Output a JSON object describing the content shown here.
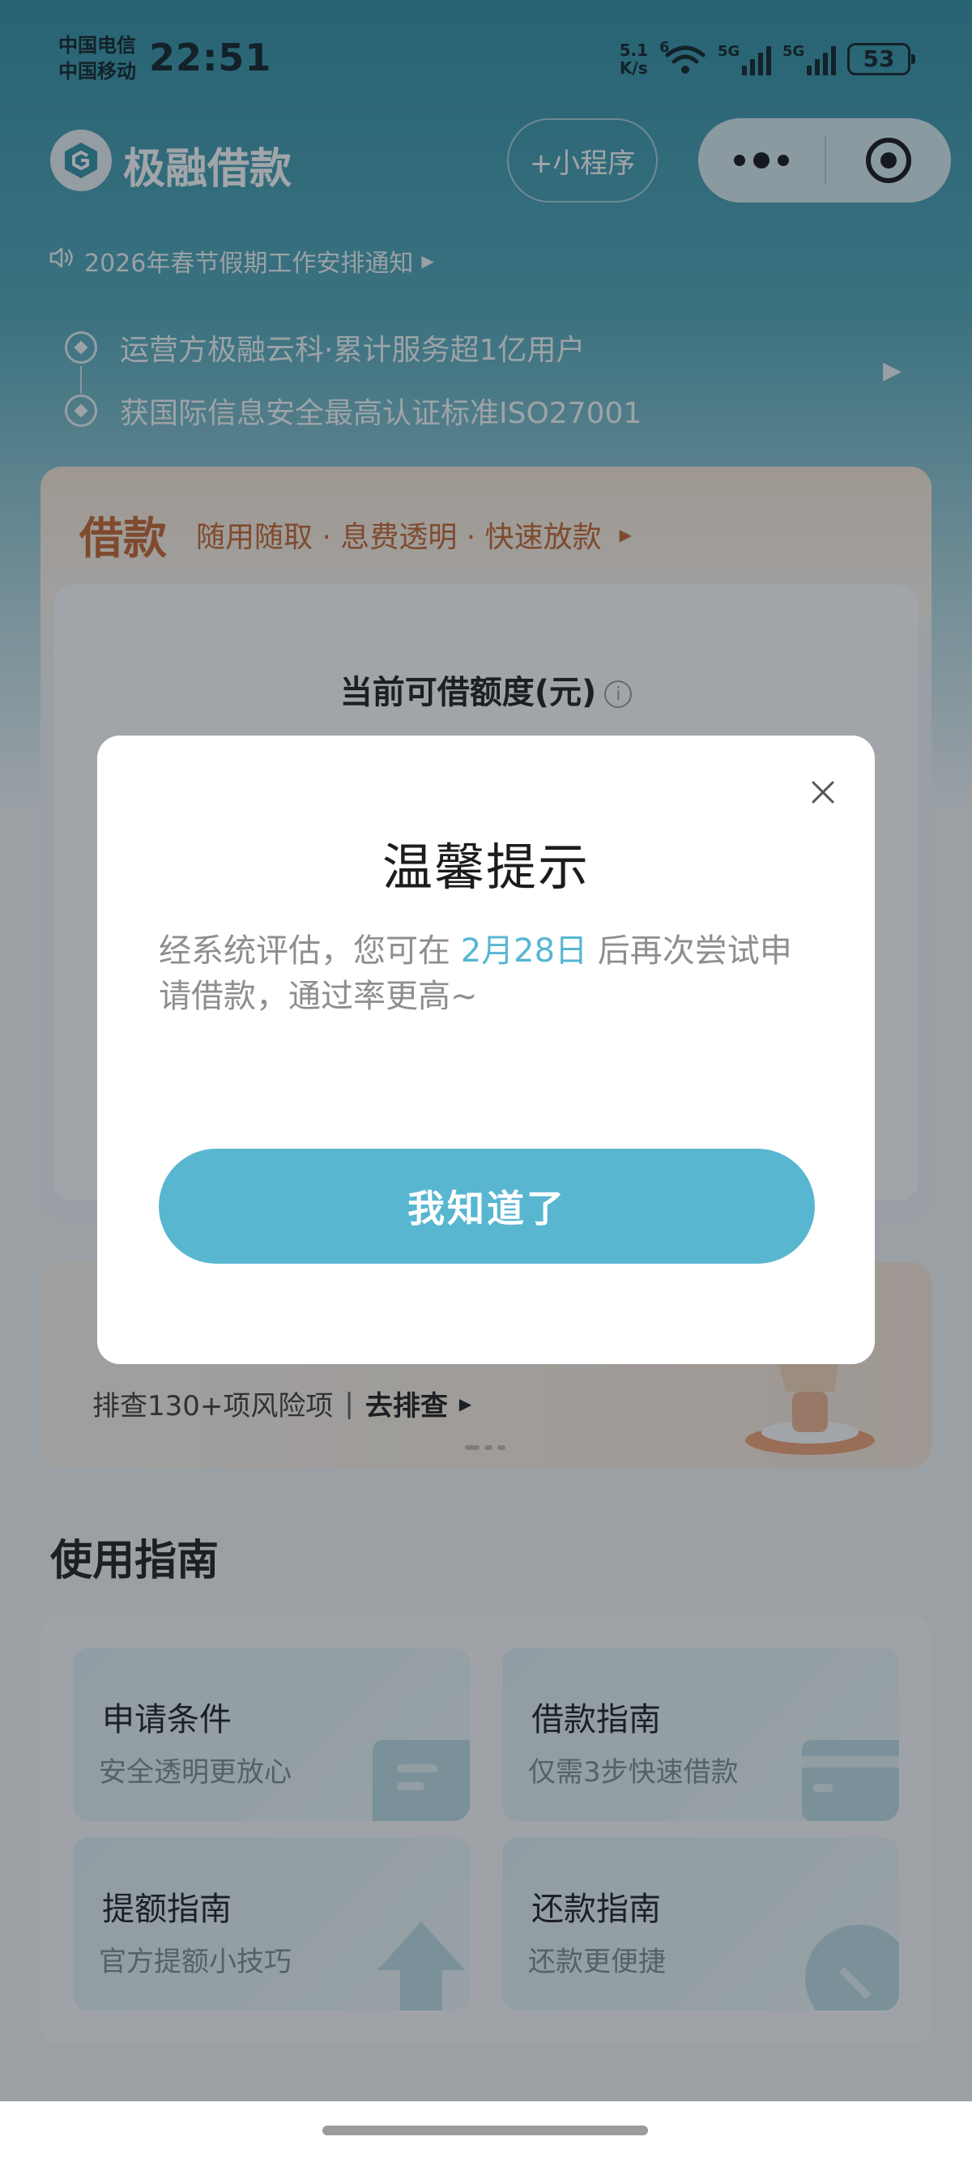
{
  "status_bar": {
    "carrier_1": "中国电信",
    "carrier_2": "中国移动",
    "time": "22:51",
    "net_speed_value": "5.1",
    "net_speed_unit": "K/s",
    "wifi_badge": "6",
    "signal_1_label": "5G",
    "signal_2_label": "5G",
    "battery": "53"
  },
  "header": {
    "app_title": "极融借款",
    "mini_program_label": "+小程序"
  },
  "notice": {
    "text": "2026年春节假期工作安排通知"
  },
  "trust": {
    "items": [
      "运营方极融云科·累计服务超1亿用户",
      "获国际信息安全最高认证标准ISO27001"
    ]
  },
  "loan_card": {
    "title": "借款",
    "tags": "随用随取 · 息费透明 · 快速放款",
    "credit_label": "当前可借额度(元)",
    "info_icon_glyph": "i"
  },
  "risk_card": {
    "subtitle": "排查130+项风险项",
    "divider": "|",
    "action": "去排查"
  },
  "guide": {
    "title": "使用指南",
    "items": [
      {
        "title": "申请条件",
        "subtitle": "安全透明更放心"
      },
      {
        "title": "借款指南",
        "subtitle": "仅需3步快速借款"
      },
      {
        "title": "提额指南",
        "subtitle": "官方提额小技巧"
      },
      {
        "title": "还款指南",
        "subtitle": "还款更便捷"
      }
    ]
  },
  "dialog": {
    "title": "温馨提示",
    "body_prefix": "经系统评估，您可在 ",
    "body_date": "2月28日",
    "body_suffix": " 后再次尝试申请借款，通过率更高~",
    "confirm_label": "我知道了"
  },
  "colors": {
    "accent": "#58b6d1",
    "brand_teal": "#2e8fa4",
    "loan_orange": "#c4622b"
  },
  "icons": {
    "logo": "brand-logo-icon",
    "wifi": "wifi-icon",
    "battery": "battery-icon",
    "speaker": "speaker-icon",
    "close": "close-icon",
    "more": "more-dots-icon",
    "target": "target-icon",
    "info": "info-icon"
  }
}
